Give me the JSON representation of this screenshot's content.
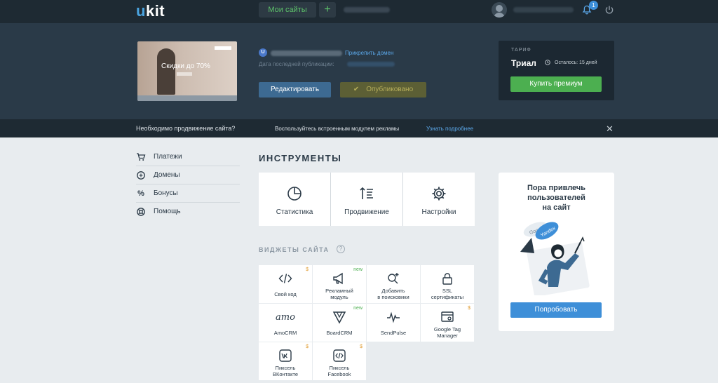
{
  "topbar": {
    "logo": "kit",
    "logo_u": "u",
    "my_sites": "Мои сайты",
    "plus": "+",
    "notifications_count": "1"
  },
  "site": {
    "attach_domain": "Прикрепить домен",
    "last_published_label": "Дата последней публикации:",
    "preview_text": "Скидки до 70%",
    "edit_button": "Редактировать",
    "published_button": "Опубликовано"
  },
  "tariff": {
    "label": "ТАРИФ",
    "plan": "Триал",
    "remaining": "Осталось: 15 дней",
    "buy_button": "Купить премиум"
  },
  "promo_bar": {
    "question": "Необходимо продвижение сайта?",
    "suggestion": "Воспользуйтесь встроенным модулем рекламы",
    "learn_more": "Узнать подробнее"
  },
  "sidebar": {
    "items": [
      {
        "label": "Платежи",
        "icon": "cart-icon"
      },
      {
        "label": "Домены",
        "icon": "domain-icon"
      },
      {
        "label": "Бонусы",
        "icon": "percent-icon"
      },
      {
        "label": "Помощь",
        "icon": "lifebuoy-icon"
      }
    ]
  },
  "tools": {
    "title": "ИНСТРУМЕНТЫ",
    "items": [
      {
        "label": "Статистика",
        "icon": "pie-chart-icon"
      },
      {
        "label": "Продвижение",
        "icon": "sort-icon"
      },
      {
        "label": "Настройки",
        "icon": "gear-icon"
      }
    ]
  },
  "widgets": {
    "title": "ВИДЖЕТЫ САЙТА",
    "help": "?",
    "items": [
      {
        "label": "Свой код",
        "tag": "$"
      },
      {
        "label1": "Рекламный",
        "label2": "модуль",
        "tag": "new"
      },
      {
        "label1": "Добавить",
        "label2": "в поисковики"
      },
      {
        "label1": "SSL",
        "label2": "сертификаты"
      },
      {
        "label": "AmoCRM",
        "logo": "amo"
      },
      {
        "label": "BoardCRM",
        "tag": "new"
      },
      {
        "label": "SendPulse"
      },
      {
        "label1": "Google Tag",
        "label2": "Manager",
        "tag": "$"
      },
      {
        "label1": "Пиксель",
        "label2": "ВКонтакте",
        "tag": "$"
      },
      {
        "label1": "Пиксель",
        "label2": "Facebook",
        "tag": "$"
      }
    ]
  },
  "promo_card": {
    "line1": "Пора привлечь",
    "line2": "пользователей",
    "line3": "на сайт",
    "bubble1": "Google",
    "bubble2": "Yandex",
    "try_button": "Попробовать"
  },
  "colors": {
    "topbar": "#1e2a33",
    "hero": "#2a3a48",
    "accent_green": "#4caf50",
    "accent_blue": "#3e8fd8"
  }
}
